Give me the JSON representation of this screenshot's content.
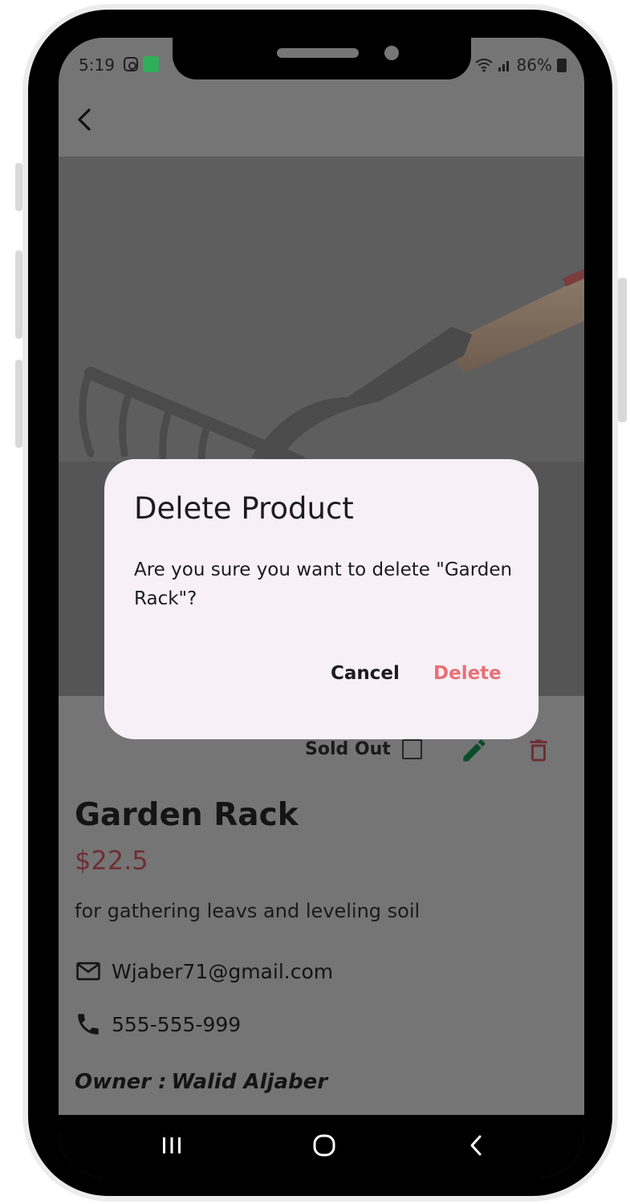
{
  "status_bar": {
    "time": "5:19",
    "battery": "86%"
  },
  "product": {
    "title": "Garden Rack",
    "price": "$22.5",
    "description": "for gathering leavs and leveling soil",
    "email": "Wjaber71@gmail.com",
    "phone": "555-555-999",
    "owner_label": "Owner :",
    "owner_name": "Walid Aljaber"
  },
  "actions": {
    "sold_out_label": "Sold Out",
    "sold_out_checked": false
  },
  "dialog": {
    "title": "Delete Product",
    "message": "Are you sure you want to delete \"Garden Rack\"?",
    "cancel_label": "Cancel",
    "delete_label": "Delete"
  },
  "colors": {
    "scrim": "#757575",
    "dialog_bg": "#f7f1f7",
    "price": "#6d2f34",
    "delete_action": "#e97077",
    "edit_icon": "#0b4d2a",
    "delete_icon": "#6d2f34"
  },
  "icons": {
    "back": "arrow-back-icon",
    "edit": "pencil-icon",
    "delete": "trash-icon",
    "email": "mail-icon",
    "phone": "phone-icon"
  }
}
